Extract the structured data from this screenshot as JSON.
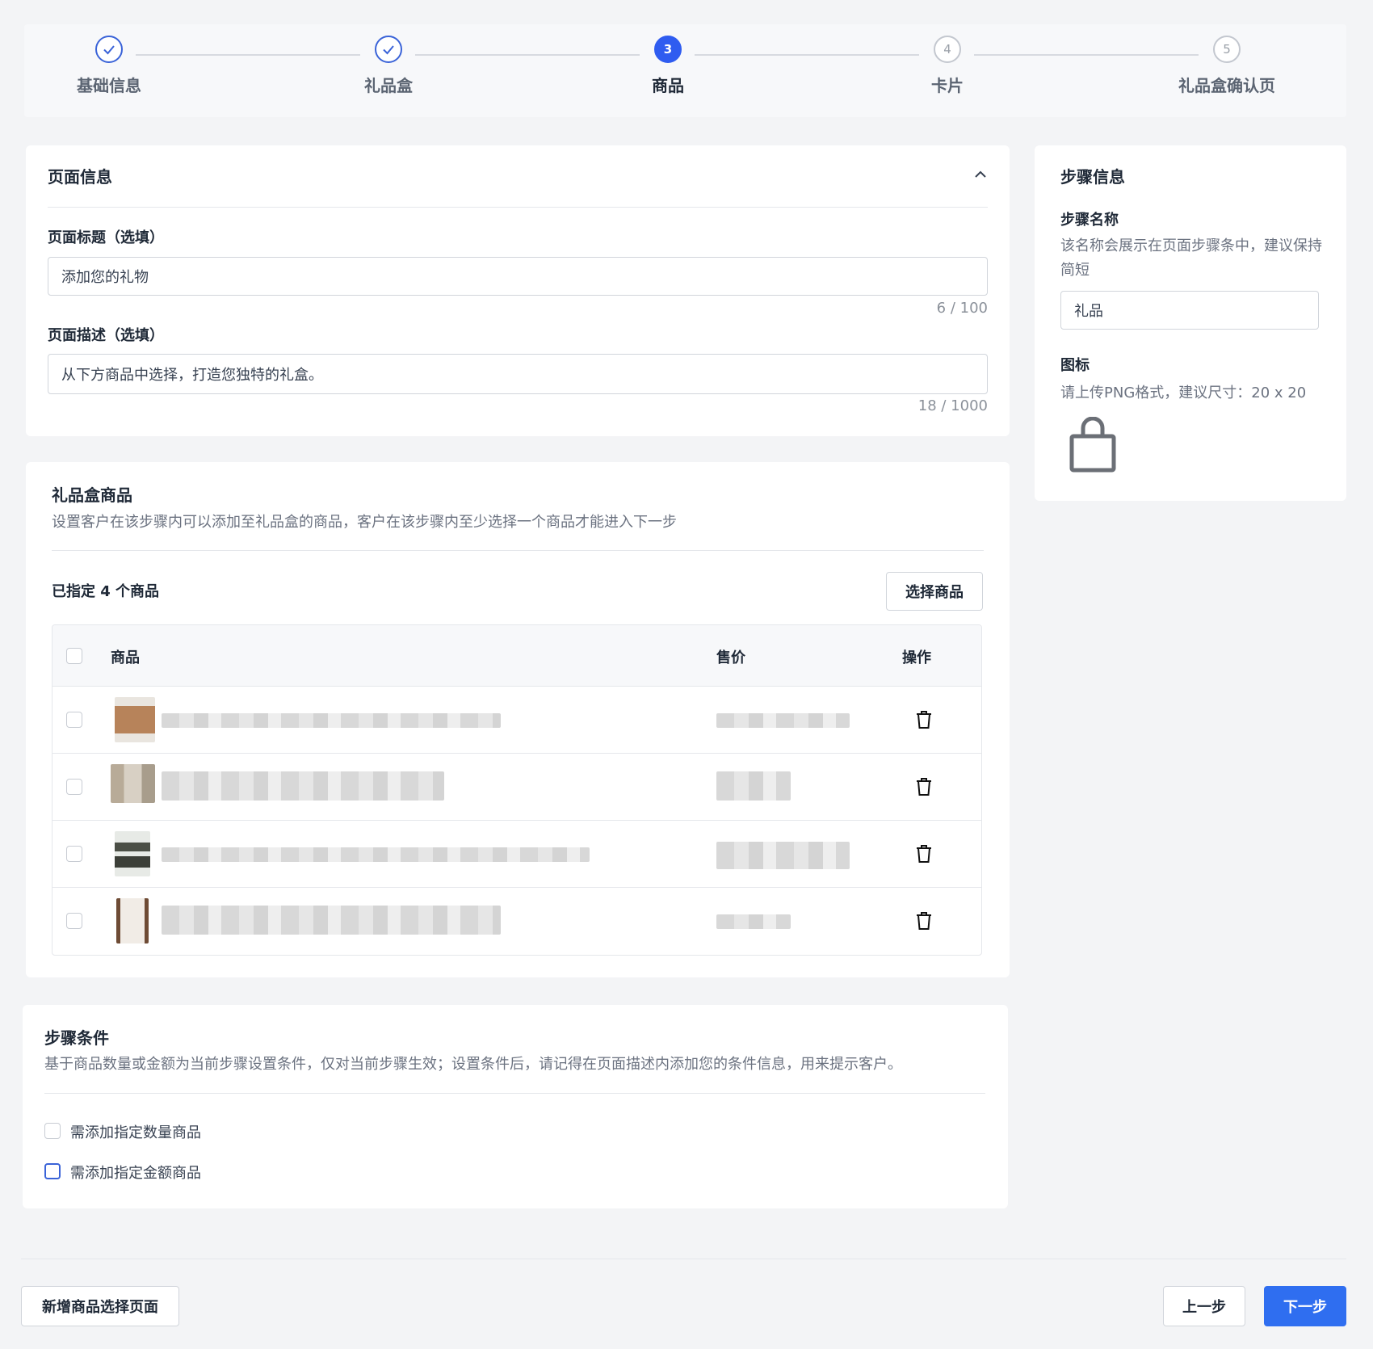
{
  "stepper": {
    "steps": [
      {
        "label": "基础信息",
        "state": "done",
        "num": ""
      },
      {
        "label": "礼品盒",
        "state": "done",
        "num": ""
      },
      {
        "label": "商品",
        "state": "active",
        "num": "3"
      },
      {
        "label": "卡片",
        "state": "pending",
        "num": "4"
      },
      {
        "label": "礼品盒确认页",
        "state": "pending",
        "num": "5"
      }
    ]
  },
  "page_info": {
    "title": "页面信息",
    "page_title_label": "页面标题（选填）",
    "page_title_value": "添加您的礼物",
    "page_title_counter": "6 / 100",
    "page_desc_label": "页面描述（选填）",
    "page_desc_value": "从下方商品中选择，打造您独特的礼盒。",
    "page_desc_counter": "18 / 1000"
  },
  "step_info": {
    "title": "步骤信息",
    "name_label": "步骤名称",
    "name_help": "该名称会展示在页面步骤条中，建议保持简短",
    "name_value": "礼品",
    "icon_label": "图标",
    "icon_help": "请上传PNG格式，建议尺寸：20 x 20",
    "icon_name": "shopping-bag-icon"
  },
  "gift_products": {
    "title": "礼品盒商品",
    "desc": "设置客户在该步骤内可以添加至礼品盒的商品，客户在该步骤内至少选择一个商品才能进入下一步",
    "count_text": "已指定 4 个商品",
    "select_button": "选择商品",
    "columns": {
      "product": "商品",
      "price": "售价",
      "action": "操作"
    }
  },
  "conditions": {
    "title": "步骤条件",
    "desc": "基于商品数量或金额为当前步骤设置条件，仅对当前步骤生效；设置条件后，请记得在页面描述内添加您的条件信息，用来提示客户。",
    "option_qty": "需添加指定数量商品",
    "option_amount": "需添加指定金额商品"
  },
  "footer": {
    "add_page_button": "新增商品选择页面",
    "prev_button": "上一步",
    "next_button": "下一步"
  },
  "colors": {
    "accent": "#2f6ef0",
    "step_active": "#2f5cf0"
  }
}
